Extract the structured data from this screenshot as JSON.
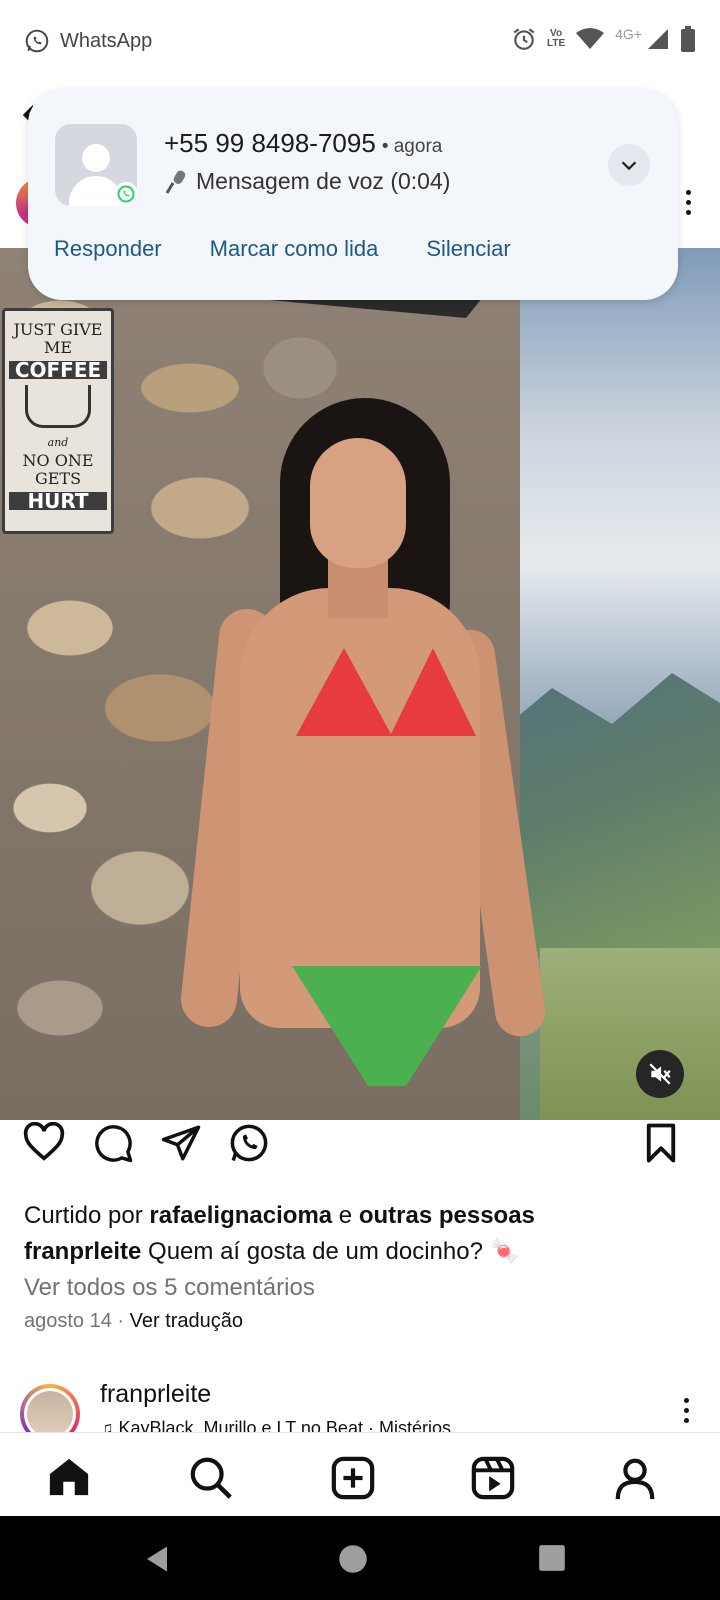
{
  "status_bar": {
    "app_name": "WhatsApp",
    "volte_line1": "Vo",
    "volte_line2": "LTE",
    "network": "4G+"
  },
  "notification": {
    "sender": "+55 99 8498-7095",
    "time": "• agora",
    "message": "Mensagem de voz (0:04)",
    "actions": [
      "Responder",
      "Marcar como lida",
      "Silenciar"
    ]
  },
  "photo_sign": {
    "line1": "JUST GIVE ME",
    "line2": "COFFEE",
    "line3": "and",
    "line4": "NO ONE GETS",
    "line5": "HURT"
  },
  "post": {
    "liked_prefix": "Curtido por ",
    "liked_user": "rafaelignacioma",
    "liked_middle": " e ",
    "liked_suffix": "outras pessoas",
    "caption_user": "franprleite",
    "caption_text": " Quem aí gosta de um docinho? 🍬",
    "view_comments": "Ver todos os 5 comentários",
    "date": "agosto 14",
    "separator": " · ",
    "translate": "Ver tradução"
  },
  "next_post": {
    "username": "franprleite",
    "audio": "♫ KayBlack, Murillo e LT no Beat · Mistérios"
  },
  "colors": {
    "notif_bg": "#f3f6fb",
    "notif_action": "#1c5a86",
    "whatsapp_green": "#25d366"
  }
}
